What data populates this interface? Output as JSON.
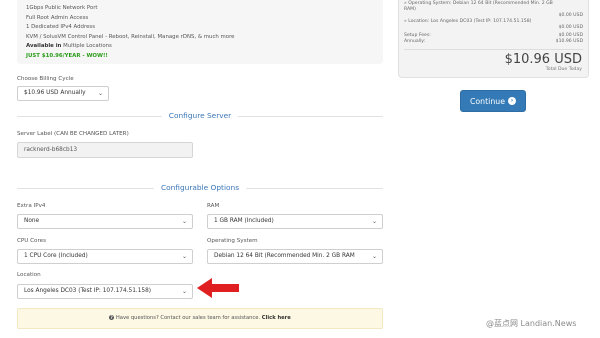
{
  "product": {
    "lines": [
      "1Gbps Public Network Port",
      "Full Root Admin Access",
      "1 Dedicated IPv4 Address",
      "KVM / SolusVM Control Panel - Reboot, Reinstall, Manage rDNS, & much more"
    ],
    "available_bold": "Available in",
    "available_rest": " Multiple Locations",
    "promo": "JUST $10.96/YEAR - WOW!!"
  },
  "summary": {
    "os_line1": "» Operating System: Debian 12 64 Bit (Recommended Min. 2 GB",
    "os_line2": "RAM)",
    "os_price": "$0.00 USD",
    "location_line": "» Location: Los Angeles DC03 (Test IP: 107.174.51.158)",
    "location_price": "$0.00 USD",
    "setup_label": "Setup Fees:",
    "setup_price": "$0.00 USD",
    "annually_label": "Annually:",
    "annually_price": "$10.96 USD",
    "total": "$10.96 USD",
    "total_label": "Total Due Today"
  },
  "continue_label": "Continue",
  "billing": {
    "label": "Choose Billing Cycle",
    "value": "$10.96 USD Annually"
  },
  "configure_server_title": "Configure Server",
  "server_label": {
    "label": "Server Label (CAN BE CHANGED LATER)",
    "value": "racknerd-b68cb13"
  },
  "configurable_options_title": "Configurable Options",
  "options": {
    "extra_ipv4_label": "Extra IPv4",
    "extra_ipv4_value": "None",
    "ram_label": "RAM",
    "ram_value": "1 GB RAM (Included)",
    "cpu_label": "CPU Cores",
    "cpu_value": "1 CPU Core (Included)",
    "os_label": "Operating System",
    "os_value": "Debian 12 64 Bit (Recommended Min. 2 GB RAM",
    "location_label": "Location",
    "location_value": "Los Angeles DC03 (Test IP: 107.174.51.158)"
  },
  "help": {
    "text": " Have questions? Contact our sales team for assistance. ",
    "link": "Click here"
  },
  "watermark": "@蓝点网 Landian.News",
  "colors": {
    "accent": "#337ab7",
    "section_title": "#3b76b6",
    "promo": "#2a9c19",
    "arrow": "#e02020",
    "help_bg": "#fcf8e3"
  },
  "icons": [
    "chevron-down-icon",
    "arrow-right-circle-icon",
    "question-circle-icon",
    "red-arrow-icon"
  ]
}
